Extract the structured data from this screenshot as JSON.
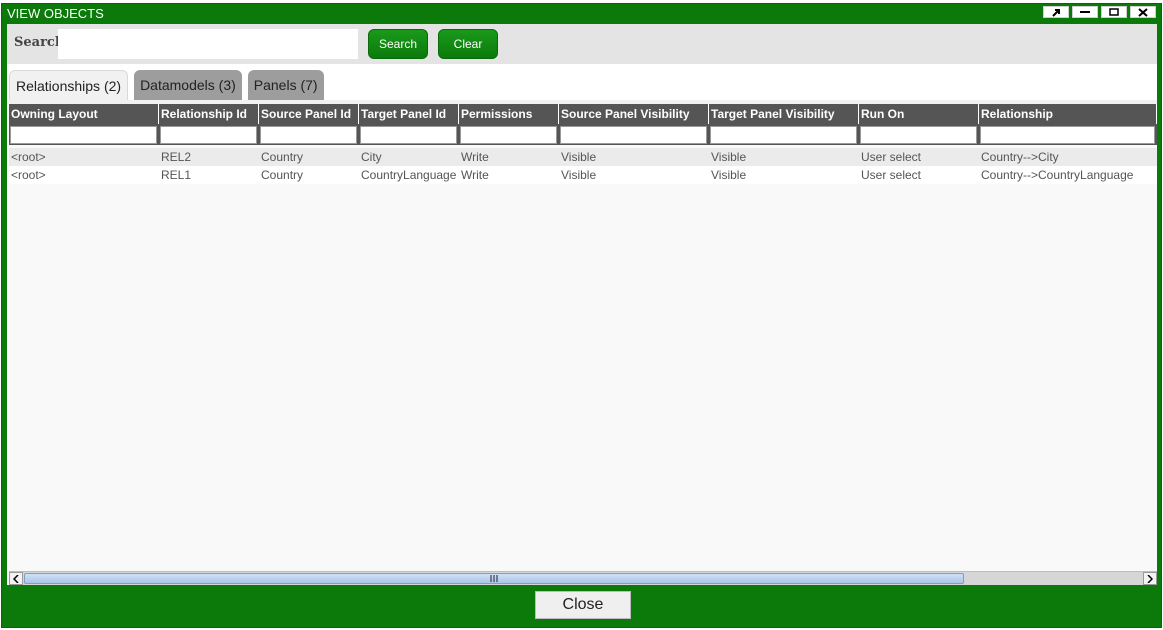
{
  "window": {
    "title": "VIEW OBJECTS"
  },
  "search": {
    "label": "Search",
    "value": "",
    "search_button": "Search",
    "clear_button": "Clear"
  },
  "tabs": [
    {
      "label": "Relationships (2)",
      "active": true
    },
    {
      "label": "Datamodels (3)",
      "active": false
    },
    {
      "label": "Panels (7)",
      "active": false
    }
  ],
  "table": {
    "columns": [
      "Owning Layout",
      "Relationship Id",
      "Source Panel Id",
      "Target Panel Id",
      "Permissions",
      "Source Panel Visibility",
      "Target Panel Visibility",
      "Run On",
      "Relationship"
    ],
    "rows": [
      [
        "<root>",
        "REL2",
        "Country",
        "City",
        "Write",
        "Visible",
        "Visible",
        "User select",
        "Country-->City"
      ],
      [
        "<root>",
        "REL1",
        "Country",
        "CountryLanguage",
        "Write",
        "Visible",
        "Visible",
        "User select",
        "Country-->CountryLanguage"
      ]
    ]
  },
  "footer": {
    "close_button": "Close"
  },
  "colors": {
    "accent": "#0b7a0b",
    "header_bg": "#555555",
    "button_green": "#1a9a1a"
  }
}
